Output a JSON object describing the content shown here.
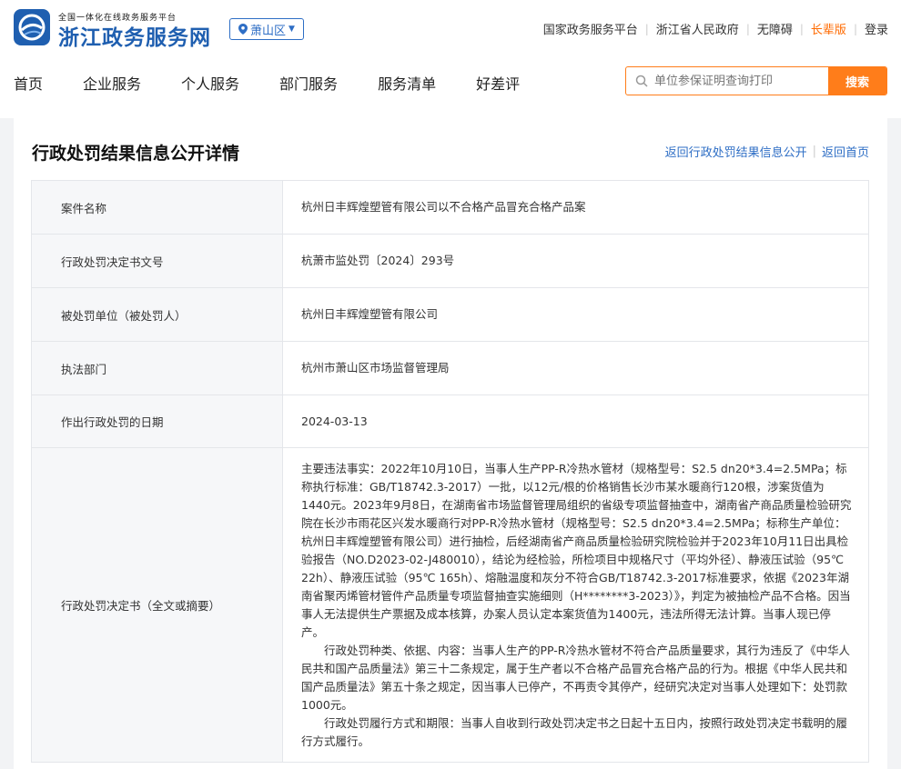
{
  "header": {
    "logo_small": "全国一体化在线政务服务平台",
    "logo_big": "浙江政务服务网",
    "region": "萧山区",
    "links": [
      "国家政务服务平台",
      "浙江省人民政府",
      "无障碍",
      "长辈版",
      "登录"
    ]
  },
  "nav": {
    "items": [
      "首页",
      "企业服务",
      "个人服务",
      "部门服务",
      "服务清单",
      "好差评"
    ]
  },
  "search": {
    "placeholder": "单位参保证明查询打印",
    "button": "搜索"
  },
  "page": {
    "title": "行政处罚结果信息公开详情",
    "crumb_back": "返回行政处罚结果信息公开",
    "crumb_home": "返回首页"
  },
  "rows": [
    {
      "label": "案件名称",
      "value": "杭州日丰辉煌塑管有限公司以不合格产品冒充合格产品案"
    },
    {
      "label": "行政处罚决定书文号",
      "value": "杭萧市监处罚〔2024〕293号"
    },
    {
      "label": "被处罚单位（被处罚人）",
      "value": "杭州日丰辉煌塑管有限公司"
    },
    {
      "label": "执法部门",
      "value": "杭州市萧山区市场监督管理局"
    },
    {
      "label": "作出行政处罚的日期",
      "value": "2024-03-13"
    }
  ],
  "decision": {
    "label": "行政处罚决定书（全文或摘要）",
    "p1": "主要违法事实：2022年10月10日，当事人生产PP-R冷热水管材（规格型号：S2.5 dn20*3.4=2.5MPa；标称执行标准：GB/T18742.3-2017）一批，以12元/根的价格销售长沙市某水暖商行120根，涉案货值为1440元。2023年9月8日，在湖南省市场监督管理局组织的省级专项监督抽查中，湖南省产商品质量检验研究院在长沙市雨花区兴发水暖商行对PP-R冷热水管材（规格型号：S2.5 dn20*3.4=2.5MPa；标称生产单位：杭州日丰辉煌塑管有限公司）进行抽检，后经湖南省产商品质量检验研究院检验并于2023年10月11日出具检验报告（NO.D2023-02-J480010），结论为经检验，所检项目中规格尺寸（平均外径）、静液压试验（95℃ 22h）、静液压试验（95℃ 165h）、熔融温度和灰分不符合GB/T18742.3-2017标准要求，依据《2023年湖南省聚丙烯管材管件产品质量专项监督抽查实施细则（H********3-2023）》，判定为被抽检产品不合格。因当事人无法提供生产票据及成本核算，办案人员认定本案货值为1400元，违法所得无法计算。当事人现已停产。",
    "p2": "行政处罚种类、依据、内容：当事人生产的PP-R冷热水管材不符合产品质量要求，其行为违反了《中华人民共和国产品质量法》第三十二条规定，属于生产者以不合格产品冒充合格产品的行为。根据《中华人民共和国产品质量法》第五十条之规定，因当事人已停产，不再责令其停产，经研究决定对当事人处理如下：处罚款1000元。",
    "p3": "行政处罚履行方式和期限：当事人自收到行政处罚决定书之日起十五日内，按照行政处罚决定书载明的履行方式履行。"
  },
  "colors": {
    "brand_blue": "#1f5fb0",
    "link_blue": "#2e6ec5",
    "accent_orange": "#ff7d1a",
    "elder_orange": "#ff6a00"
  }
}
